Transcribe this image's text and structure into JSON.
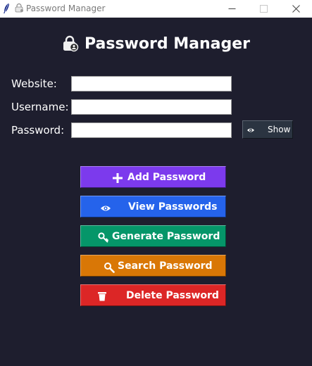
{
  "window": {
    "title": "Password Manager"
  },
  "header": {
    "title": "Password Manager",
    "icon": "lock-badge-icon"
  },
  "form": {
    "website": {
      "label": "Website:",
      "value": ""
    },
    "username": {
      "label": "Username:",
      "value": ""
    },
    "password": {
      "label": "Password:",
      "value": ""
    },
    "show_button": {
      "label": "Show",
      "icon": "eye-icon"
    }
  },
  "actions": {
    "add": {
      "label": "Add Password",
      "icon": "plus-icon",
      "color": "#7c3aed"
    },
    "view": {
      "label": "View Passwords",
      "icon": "eye-icon",
      "color": "#2563eb"
    },
    "generate": {
      "label": "Generate Password",
      "icon": "key-icon",
      "color": "#059669"
    },
    "search": {
      "label": "Search Password",
      "icon": "magnifier-icon",
      "color": "#d97706"
    },
    "delete": {
      "label": "Delete Password",
      "icon": "trash-icon",
      "color": "#dc2626"
    }
  },
  "colors": {
    "background": "#1e1e2e",
    "titlebar": "#ffffff",
    "show_button": "#2b3441"
  }
}
